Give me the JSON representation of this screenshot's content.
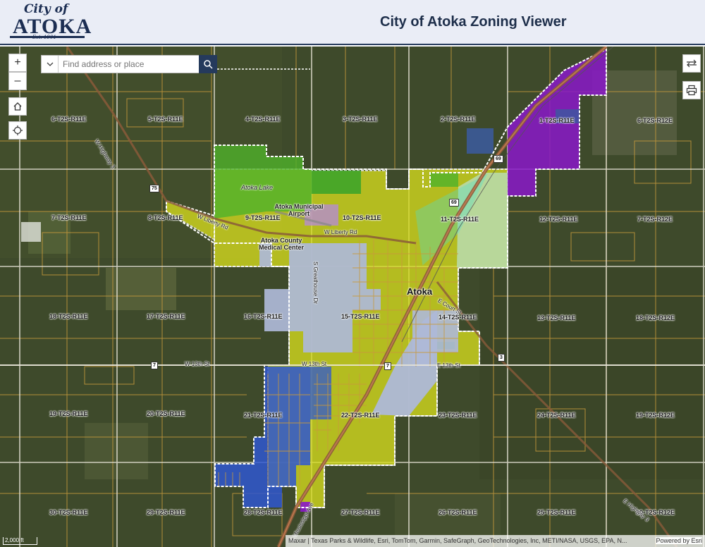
{
  "header": {
    "logo_script": "City of",
    "logo_name": "ATOKA",
    "logo_est": "Est. 1901",
    "title": "City of Atoka Zoning Viewer"
  },
  "search": {
    "placeholder": "Find address or place"
  },
  "controls": {
    "zoom_in": "+",
    "zoom_out": "–",
    "home_icon": "home-icon",
    "locate_icon": "locate-icon",
    "swap_icon": "swap-icon",
    "print_icon": "print-icon"
  },
  "colors": {
    "header_bg": "#eaedf6",
    "header_border": "#253a5c",
    "imagery": "#3e4a2b",
    "zone_yellow": "#d6dc1e",
    "zone_green": "#4fb22a",
    "zone_lightblue": "#aeb8d8",
    "zone_blue": "#2f57d0",
    "zone_purple": "#8a17c9",
    "zone_paleteal": "#b8dcb0",
    "parcel_lines": "#c89a3c",
    "grid": "#e8e4d8"
  },
  "townships": {
    "t1": "6-T2S-R11E",
    "t2": "5-T2S-R11E",
    "t3": "4-T2S-R11E",
    "t4": "3-T2S-R11E",
    "t5": "2-T2S-R11E",
    "t6": "1-T2S-R11E",
    "t7": "6-T2S-R12E",
    "t8": "7-T2S-R11E",
    "t9": "8-T2S-R11E",
    "t10": "9-T2S-R11E",
    "t11": "10-T2S-R11E",
    "t12": "11-T2S-R11E",
    "t13": "12-T2S-R11E",
    "t14": "7-T2S-R12E",
    "t15": "18-T2S-R11E",
    "t16": "17-T2S-R11E",
    "t17": "16-T2S-R11E",
    "t18": "15-T2S-R11E",
    "t19": "14-T2S-R11E",
    "t20": "13-T2S-R11E",
    "t21": "18-T2S-R12E",
    "t22": "19-T2S-R11E",
    "t23": "20-T2S-R11E",
    "t24": "21-T2S-R11E",
    "t25": "22-T2S-R11E",
    "t26": "23-T2S-R11E",
    "t27": "24-T2S-R11E",
    "t28": "19-T2S-R12E",
    "t29": "30-T2S-R11E",
    "t30": "29-T2S-R11E",
    "t31": "28-T2S-R11E",
    "t32": "27-T2S-R11E",
    "t33": "26-T2S-R11E",
    "t34": "25-T2S-R11E",
    "t35": "30-T2S-R12E"
  },
  "places": {
    "lake": "Atoka Lake",
    "airport": "Atoka Municipal Airport",
    "medical": "Atoka County Medical Center",
    "city": "Atoka"
  },
  "roads": {
    "hwy3": "W Highway 3",
    "liberty_w": "W Liberty Rd",
    "liberty": "W Liberty Rd",
    "greathouse": "S Greathouse Dr",
    "court": "E Court St",
    "w13": "W 13th St",
    "w13b": "W 13th St",
    "e13": "E 13th St",
    "mississippi": "S Mississippi Ave",
    "e_hwy": "E Highway 3"
  },
  "shields": {
    "s75": "75",
    "s69a": "69",
    "s69b": "69",
    "s7a": "7",
    "s7b": "7",
    "s3": "3"
  },
  "scale_label": "2,000 ft",
  "attribution": "Maxar | Texas Parks & Wildlife, Esri, TomTom, Garmin, SafeGraph, GeoTechnologies, Inc, METI/NASA, USGS, EPA, N...",
  "powered_by": "Powered by Esri"
}
